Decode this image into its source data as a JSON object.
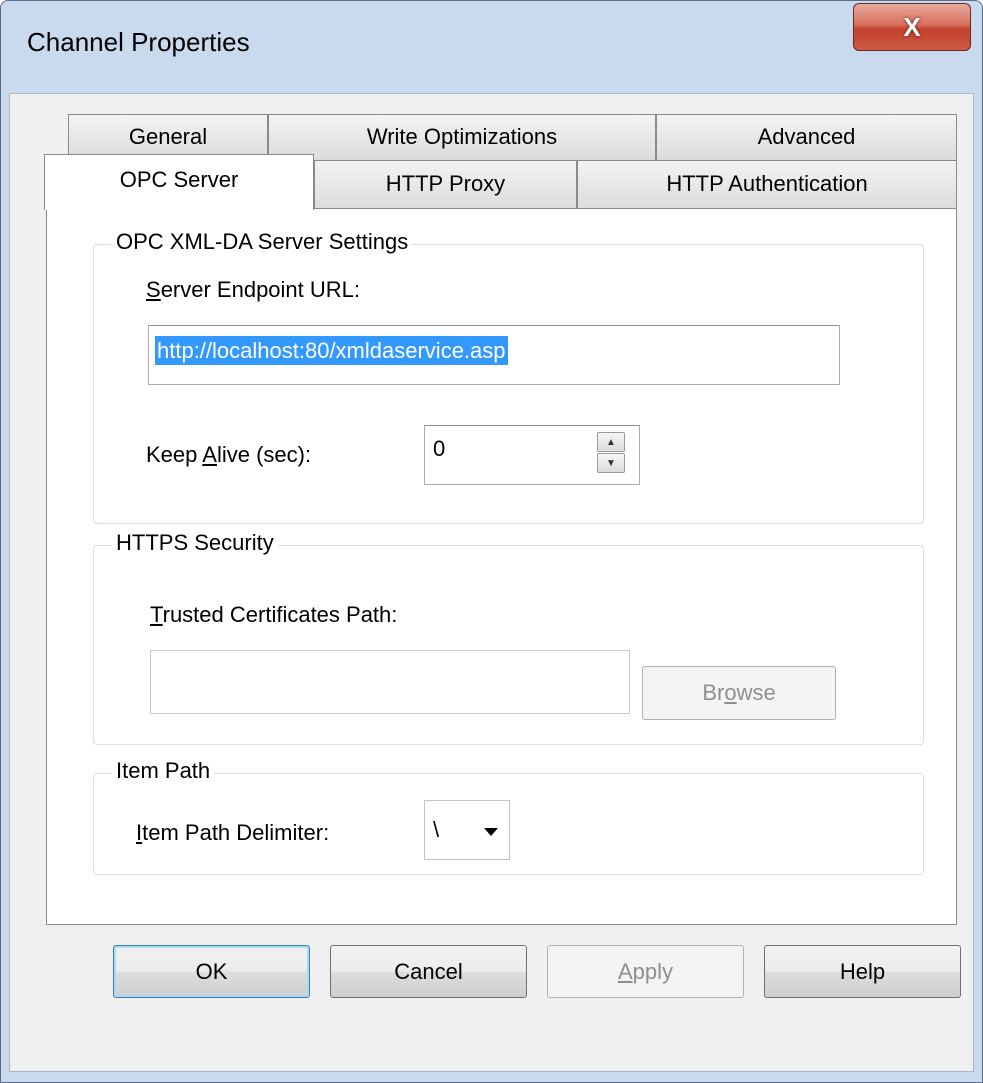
{
  "window": {
    "title": "Channel Properties",
    "close_glyph": "X"
  },
  "tabs": {
    "row_back": [
      {
        "label": "General"
      },
      {
        "label": "Write Optimizations"
      },
      {
        "label": "Advanced"
      }
    ],
    "row_front": [
      {
        "label": "OPC Server",
        "active": true
      },
      {
        "label": "HTTP Proxy",
        "active": false
      },
      {
        "label": "HTTP Authentication",
        "active": false
      }
    ]
  },
  "opc_settings": {
    "legend": "OPC XML-DA Server Settings",
    "endpoint_label": "Server Endpoint URL:",
    "endpoint_value": "http://localhost:80/xmldaservice.asp",
    "keepalive_label": "Keep Alive (sec):",
    "keepalive_value": "0",
    "spin_up_icon": "spin-up-icon",
    "spin_down_icon": "spin-down-icon"
  },
  "https_security": {
    "legend": "HTTPS Security",
    "certs_label": "Trusted Certificates Path:",
    "certs_value": "",
    "browse_label": "Browse"
  },
  "item_path": {
    "legend": "Item Path",
    "delimiter_label": "Item Path Delimiter:",
    "delimiter_value": "\\",
    "dropdown_icon": "chevron-down-icon"
  },
  "buttons": {
    "ok": "OK",
    "cancel": "Cancel",
    "apply": "Apply",
    "help": "Help"
  },
  "colors": {
    "selection": "#3399ff",
    "close_button": "#c3412c",
    "frame": "#c9d9ee"
  }
}
